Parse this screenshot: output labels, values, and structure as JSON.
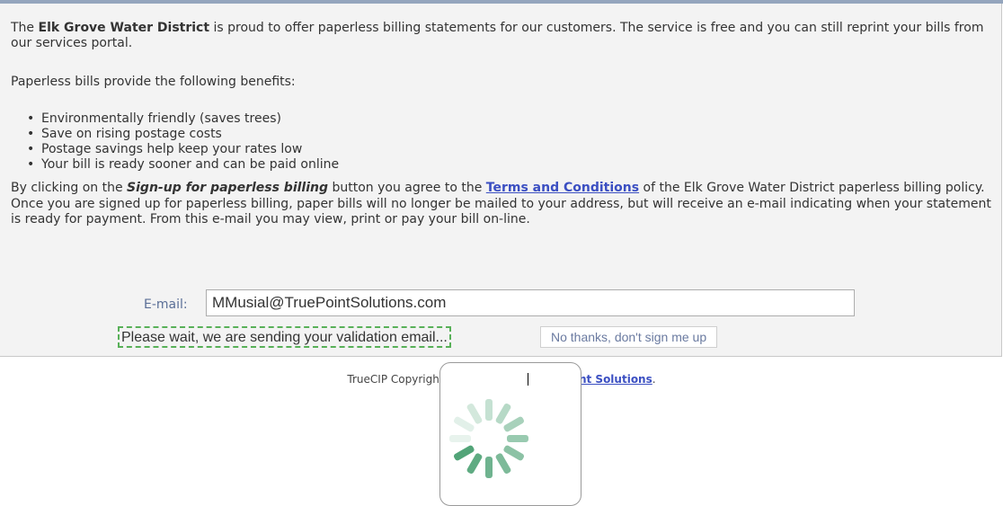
{
  "intro": {
    "prefix": "The ",
    "district_name": "Elk Grove Water District",
    "suffix": " is proud to offer paperless billing statements for our customers. The service is free and you can still reprint your bills from our services portal."
  },
  "benefits": {
    "heading": "Paperless bills provide the following benefits:",
    "items": [
      "Environmentally friendly (saves trees)",
      "Save on rising postage costs",
      "Postage savings help keep your rates low",
      "Your bill is ready sooner and can be paid online"
    ]
  },
  "terms": {
    "prefix": "By clicking on the ",
    "button_ref": "Sign-up for paperless billing",
    "middle": " button you agree to the ",
    "link": "Terms and Conditions",
    "suffix": " of the Elk Grove Water District paperless billing policy. Once you are signed up for paperless billing, paper bills will no longer be mailed to your address, but will receive an e-mail indicating when your statement is ready for payment. From this e-mail you may view, print or pay your bill on-line."
  },
  "form": {
    "email_label": "E-mail:",
    "email_value": "MMusial@TruePointSolutions.com",
    "status_text": "Please wait, we are sending your validation email...",
    "no_thanks_label": "No thanks, don't sign me up"
  },
  "footer": {
    "prefix": "TrueCIP Copyrigh",
    "link": "Point Solutions",
    "suffix": "."
  },
  "colors": {
    "accent_link": "#3b4fc2",
    "spinner": "#3f9a69",
    "status_border": "#58b058"
  },
  "icons": {
    "loading": "loading-spinner-icon"
  }
}
